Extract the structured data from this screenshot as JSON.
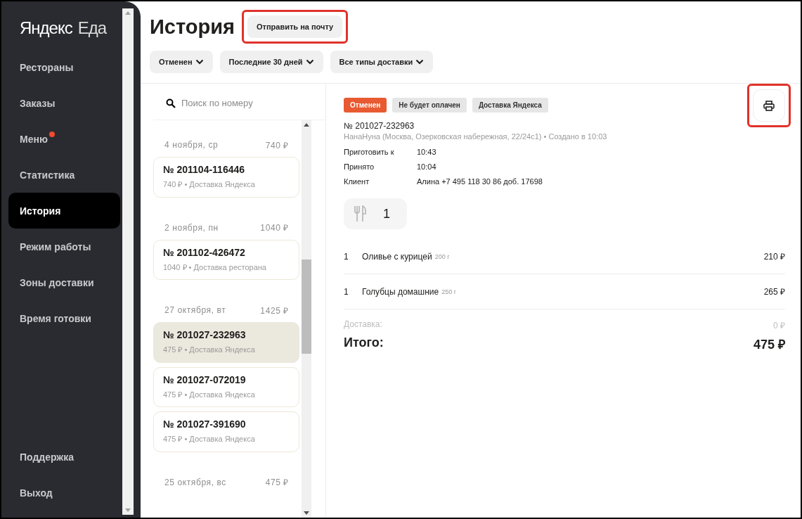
{
  "sidebar": {
    "logo": {
      "brand": "Яндекс",
      "product": "Еда"
    },
    "items": [
      {
        "label": "Рестораны",
        "selected": false,
        "notification": false
      },
      {
        "label": "Заказы",
        "selected": false,
        "notification": false
      },
      {
        "label": "Меню",
        "selected": false,
        "notification": true
      },
      {
        "label": "Статистика",
        "selected": false,
        "notification": false
      },
      {
        "label": "История",
        "selected": true,
        "notification": false
      },
      {
        "label": "Режим работы",
        "selected": false,
        "notification": false
      },
      {
        "label": "Зоны доставки",
        "selected": false,
        "notification": false
      },
      {
        "label": "Время готовки",
        "selected": false,
        "notification": false
      }
    ],
    "bottom_items": [
      {
        "label": "Поддержка",
        "selected": false
      },
      {
        "label": "Выход",
        "selected": false
      }
    ]
  },
  "header": {
    "title": "История",
    "email_button": {
      "label": "Отправить на почту",
      "highlighted": true
    }
  },
  "filters": [
    {
      "label": "Отменен"
    },
    {
      "label": "Последние 30 дней"
    },
    {
      "label": "Все типы доставки"
    }
  ],
  "search": {
    "placeholder": "Поиск по номеру"
  },
  "order_groups": [
    {
      "date": "4 ноября, ср",
      "total": "740 ₽",
      "orders": [
        {
          "number": "№ 201104-116446",
          "summary": "740 ₽ • Доставка Яндекса",
          "selected": false
        }
      ]
    },
    {
      "date": "2 ноября, пн",
      "total": "1040 ₽",
      "orders": [
        {
          "number": "№ 201102-426472",
          "summary": "1040 ₽ • Доставка ресторана",
          "selected": false
        }
      ]
    },
    {
      "date": "27 октября, вт",
      "total": "1425 ₽",
      "orders": [
        {
          "number": "№ 201027-232963",
          "summary": "475 ₽ • Доставка Яндекса",
          "selected": true
        },
        {
          "number": "№ 201027-072019",
          "summary": "475 ₽ • Доставка Яндекса",
          "selected": false
        },
        {
          "number": "№ 201027-391690",
          "summary": "475 ₽ • Доставка Яндекса",
          "selected": false
        }
      ]
    },
    {
      "date": "25 октября, вс",
      "total": "475 ₽"
    }
  ],
  "detail": {
    "badges": [
      {
        "label": "Отменен",
        "kind": "status"
      },
      {
        "label": "Не будет оплачен",
        "kind": "tag"
      },
      {
        "label": "Доставка Яндекса",
        "kind": "tag"
      }
    ],
    "number": "№ 201027-232963",
    "meta": "НанаНуна (Москва, Озерковская набережная, 22/24с1) • Создано в 10:03",
    "fields": [
      {
        "label": "Приготовить к",
        "value": "10:43"
      },
      {
        "label": "Принято",
        "value": "10:04"
      },
      {
        "label": "Клиент",
        "value": "Алина +7 495 118 30 86 доб. 17698"
      }
    ],
    "cutlery": {
      "count": "1"
    },
    "items": [
      {
        "qty": "1",
        "name": "Оливье с курицей",
        "weight": "200 г",
        "price": "210 ₽"
      },
      {
        "qty": "1",
        "name": "Голубцы домашние",
        "weight": "250 г",
        "price": "265 ₽"
      }
    ],
    "delivery": {
      "label": "Доставка:",
      "value": "0 ₽"
    },
    "total": {
      "label": "Итого:",
      "value": "475 ₽"
    },
    "print_button": {
      "highlighted": true
    }
  }
}
